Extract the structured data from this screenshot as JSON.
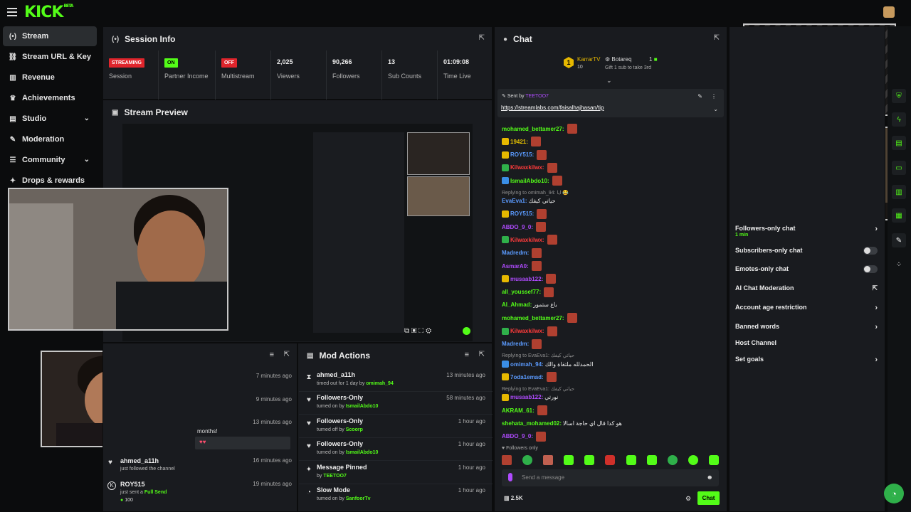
{
  "brand": {
    "logo": "KICK",
    "logo_sup": "BETA",
    "accent": "#53fc18",
    "live_red": "#e0252c"
  },
  "sidebar": {
    "items": [
      {
        "label": "Stream",
        "icon": "radio-icon",
        "active": true
      },
      {
        "label": "Stream URL & Key",
        "icon": "link-icon"
      },
      {
        "label": "Revenue",
        "icon": "chart-icon"
      },
      {
        "label": "Achievements",
        "icon": "trophy-icon"
      },
      {
        "label": "Studio",
        "icon": "studio-icon",
        "chevron": "⌄"
      },
      {
        "label": "Moderation",
        "icon": "wrench-icon"
      },
      {
        "label": "Community",
        "icon": "community-icon",
        "chevron": "⌄"
      },
      {
        "label": "Drops & rewards",
        "icon": "gift-icon"
      }
    ]
  },
  "session": {
    "title": "Session Info",
    "stats": [
      {
        "badge": "STREAMING",
        "label": "Session"
      },
      {
        "badge": "ON",
        "label": "Partner Income"
      },
      {
        "badge": "OFF",
        "label": "Multistream"
      },
      {
        "value": "2,025",
        "label": "Viewers"
      },
      {
        "value": "90,266",
        "label": "Followers"
      },
      {
        "value": "13",
        "label": "Sub Counts"
      },
      {
        "value": "01:09:08",
        "label": "Time Live"
      }
    ]
  },
  "preview": {
    "title": "Stream Preview"
  },
  "feed": {
    "rows": [
      {
        "time": "7 minutes ago"
      },
      {
        "time": "9 minutes ago"
      },
      {
        "time": "13 minutes ago",
        "text": "months!"
      },
      {
        "name": "ahmed_a11h",
        "sub": "just followed the channel",
        "time": "16 minutes ago"
      },
      {
        "name": "ROY515",
        "sub": "just sent a",
        "highlight": "Full Send",
        "amount": "100",
        "time": "19 minutes ago"
      }
    ]
  },
  "mod": {
    "title": "Mod Actions",
    "rows": [
      {
        "icon": "hourglass-icon",
        "name": "ahmed_a11h",
        "sub": "timed out for 1 day by",
        "by": "omimah_94",
        "time": "13 minutes ago"
      },
      {
        "icon": "heart-icon",
        "name": "Followers-Only",
        "sub": "turned on by",
        "by": "IsmailAbdo10",
        "time": "58 minutes ago"
      },
      {
        "icon": "heart-icon",
        "name": "Followers-Only",
        "sub": "turned off by",
        "by": "Scoorp",
        "time": "1 hour ago"
      },
      {
        "icon": "heart-icon",
        "name": "Followers-Only",
        "sub": "turned on by",
        "by": "IsmailAbdo10",
        "time": "1 hour ago"
      },
      {
        "icon": "pin-icon",
        "name": "Message Pinned",
        "sub": "by",
        "by": "TEETOO7",
        "time": "1 hour ago"
      },
      {
        "icon": "slow-icon",
        "name": "Slow Mode",
        "sub": "turned on by",
        "by": "SanfoorTv",
        "time": "1 hour ago"
      }
    ]
  },
  "chat": {
    "title": "Chat",
    "leader": {
      "rank": "1",
      "name": "KarrarTV",
      "count": "10",
      "second": "Botareq",
      "second_count": "1",
      "gift_text": "Gift 1 sub to take 3rd"
    },
    "pin": {
      "sent_by": "Sent by",
      "user": "TEETOO7",
      "link": "https://streamlabs.com/faisalhajhasan/tip"
    },
    "messages": [
      {
        "user": "mohamed_bettamer27:",
        "color": "#53fc18",
        "emote": true
      },
      {
        "user": "19421:",
        "color": "#e6c200",
        "emote": true,
        "badge": "#e6b800"
      },
      {
        "user": "ROY515:",
        "color": "#5b9bff",
        "emote": true,
        "badge": "#e6b800"
      },
      {
        "user": "Kilwaxkilwx:",
        "color": "#ff3b3b",
        "emote": true,
        "badge": "#2fb04a"
      },
      {
        "user": "IsmailAbdo10:",
        "color": "#53fc18",
        "emote": true,
        "badge": "#3a8ee6"
      },
      {
        "reply": "Replying to omimah_94: ايا 😂"
      },
      {
        "user": "EvaEva1:",
        "color": "#5b9bff",
        "text": "حياتي كيفك"
      },
      {
        "user": "ROY515:",
        "color": "#5b9bff",
        "emote": true,
        "badge": "#e6b800"
      },
      {
        "user": "ABDO_9_0:",
        "color": "#b04bff",
        "emote": true
      },
      {
        "user": "Kilwaxkilwx:",
        "color": "#ff3b3b",
        "emote": true,
        "badge": "#2fb04a"
      },
      {
        "user": "Madredm:",
        "color": "#5b9bff",
        "emote": true
      },
      {
        "user": "AsmarA0:",
        "color": "#b04bff",
        "emote": true
      },
      {
        "user": "musaab122:",
        "color": "#b04bff",
        "emote": true,
        "badge": "#e6b800"
      },
      {
        "user": "all_youssef77:",
        "color": "#53fc18",
        "emote": true
      },
      {
        "user": "Al_Ahmad:",
        "color": "#53fc18",
        "text": "باع ستمور"
      },
      {
        "user": "mohamed_bettamer27:",
        "color": "#53fc18",
        "emote": true
      },
      {
        "user": "Kilwaxkilwx:",
        "color": "#ff3b3b",
        "emote": true,
        "badge": "#2fb04a"
      },
      {
        "user": "Madredm:",
        "color": "#5b9bff",
        "emote": true
      },
      {
        "reply": "Replying to EvaEva1: حياتي كيفك"
      },
      {
        "user": "omimah_94:",
        "color": "#5b9bff",
        "text": "الحمدلله ملتقاة والك",
        "badge": "#3a8ee6"
      },
      {
        "user": "7oda1emad:",
        "color": "#5b9bff",
        "emote": true,
        "badge": "#e6b800"
      },
      {
        "reply": "Replying to EvaEva1: حياتي كيفك"
      },
      {
        "user": "musaab122:",
        "color": "#b04bff",
        "text": "نورتي",
        "badge": "#e6b800"
      },
      {
        "user": "AKRAM_61:",
        "color": "#53fc18",
        "emote": true
      },
      {
        "user": "shehata_mohamed02:",
        "color": "#53fc18",
        "text": "هو كدا قال اي حاجة اسالا"
      },
      {
        "user": "ABDO_9_0:",
        "color": "#b04bff",
        "emote": true
      }
    ],
    "followers_only": "Followers only",
    "input_placeholder": "Send a message",
    "viewers": "2.5K",
    "send_label": "Chat"
  },
  "settings": {
    "rows": [
      {
        "label": "Followers-only chat",
        "sub": "1 min",
        "control": "chevron"
      },
      {
        "label": "Subscribers-only chat",
        "control": "toggle"
      },
      {
        "label": "Emotes-only chat",
        "control": "toggle"
      },
      {
        "label": "AI Chat Moderation",
        "control": "external"
      },
      {
        "label": "Account age restriction",
        "control": "chevron"
      },
      {
        "label": "Banned words",
        "control": "chevron"
      },
      {
        "label": "Host Channel",
        "control": "none"
      },
      {
        "label": "Set goals",
        "control": "chevron"
      }
    ]
  }
}
